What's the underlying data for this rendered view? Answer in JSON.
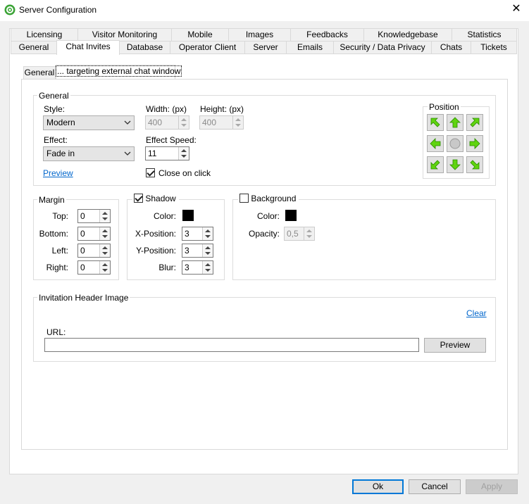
{
  "window": {
    "title": "Server Configuration",
    "close_label": "✕"
  },
  "tabs_top": [
    "Licensing",
    "Visitor Monitoring",
    "Mobile",
    "Images",
    "Feedbacks",
    "Knowledgebase",
    "Statistics"
  ],
  "tabs_bottom": [
    "General",
    "Chat Invites",
    "Database",
    "Operator Client",
    "Server",
    "Emails",
    "Security / Data Privacy",
    "Chats",
    "Tickets"
  ],
  "active_tab": "Chat Invites",
  "subtabs": [
    "General",
    "... targeting external chat window"
  ],
  "active_subtab": "... targeting external chat window",
  "general": {
    "title": "General",
    "style_label": "Style:",
    "style_value": "Modern",
    "width_label": "Width: (px)",
    "width_value": "400",
    "height_label": "Height: (px)",
    "height_value": "400",
    "effect_label": "Effect:",
    "effect_value": "Fade in",
    "effect_speed_label": "Effect Speed:",
    "effect_speed_value": "11",
    "preview_link": "Preview",
    "close_on_click_label": "Close on click",
    "close_on_click_checked": true,
    "position_title": "Position"
  },
  "margin": {
    "title": "Margin",
    "top_label": "Top:",
    "top_value": "0",
    "bottom_label": "Bottom:",
    "bottom_value": "0",
    "left_label": "Left:",
    "left_value": "0",
    "right_label": "Right:",
    "right_value": "0"
  },
  "shadow": {
    "title": "Shadow",
    "checked": true,
    "color_label": "Color:",
    "color": "#000000",
    "x_label": "X-Position:",
    "x_value": "3",
    "y_label": "Y-Position:",
    "y_value": "3",
    "blur_label": "Blur:",
    "blur_value": "3"
  },
  "background": {
    "title": "Background",
    "checked": false,
    "color_label": "Color:",
    "color": "#000000",
    "opacity_label": "Opacity:",
    "opacity_value": "0,5"
  },
  "header_image": {
    "title": "Invitation Header Image",
    "clear_link": "Clear",
    "url_label": "URL:",
    "url_value": "",
    "preview_button": "Preview"
  },
  "footer": {
    "ok": "Ok",
    "cancel": "Cancel",
    "apply": "Apply"
  },
  "colors": {
    "accent": "#0078d7",
    "arrow_green": "#5fd40f",
    "link": "#0066cc"
  }
}
